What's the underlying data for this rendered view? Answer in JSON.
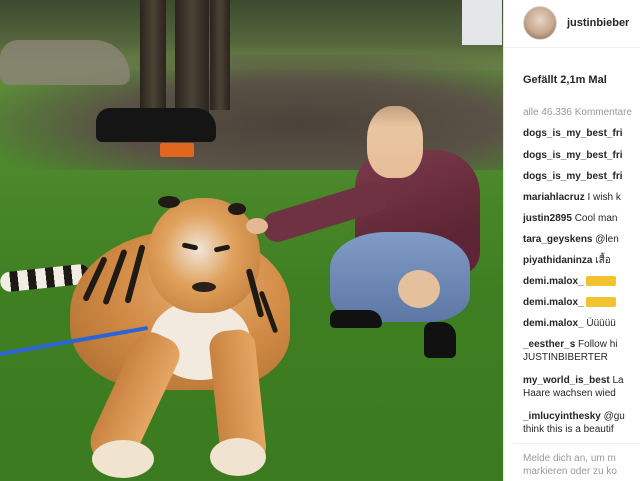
{
  "post": {
    "username": "justinbieber",
    "likes": "Gefällt 2,1m Mal",
    "more_comments": "alle 46.336 Kommentare"
  },
  "comments": [
    {
      "user": "dogs_is_my_best_fri",
      "text": ""
    },
    {
      "user": "dogs_is_my_best_fri",
      "text": ""
    },
    {
      "user": "dogs_is_my_best_fri",
      "text": ""
    },
    {
      "user": "mariahlacruz",
      "text": " I wish k"
    },
    {
      "user": "justin2895",
      "text": " Cool man"
    },
    {
      "user": "tara_geyskens",
      "text": " @len"
    },
    {
      "user": "piyathidaninza",
      "text": " เสื้อ"
    },
    {
      "user": "demi.malox_",
      "text": ""
    },
    {
      "user": "demi.malox_",
      "text": ""
    },
    {
      "user": "demi.malox_",
      "text": " Üüüüü"
    },
    {
      "user": "_eesther_s",
      "text": " Follow hi"
    },
    {
      "user": "",
      "text": "JUSTINBIBERTER"
    },
    {
      "user": "my_world_is_best",
      "text": " La"
    },
    {
      "user": "",
      "text": "Haare wachsen wied"
    },
    {
      "user": "_imlucyinthesky",
      "text": " @gu"
    },
    {
      "user": "",
      "text": "think this is a beautif"
    }
  ],
  "add_comment": {
    "line1": "Melde dich an, um m",
    "line2": "markieren oder zu ko"
  },
  "colors": {
    "text": "#262626",
    "muted": "#999999",
    "leash": "#2a64d6"
  }
}
